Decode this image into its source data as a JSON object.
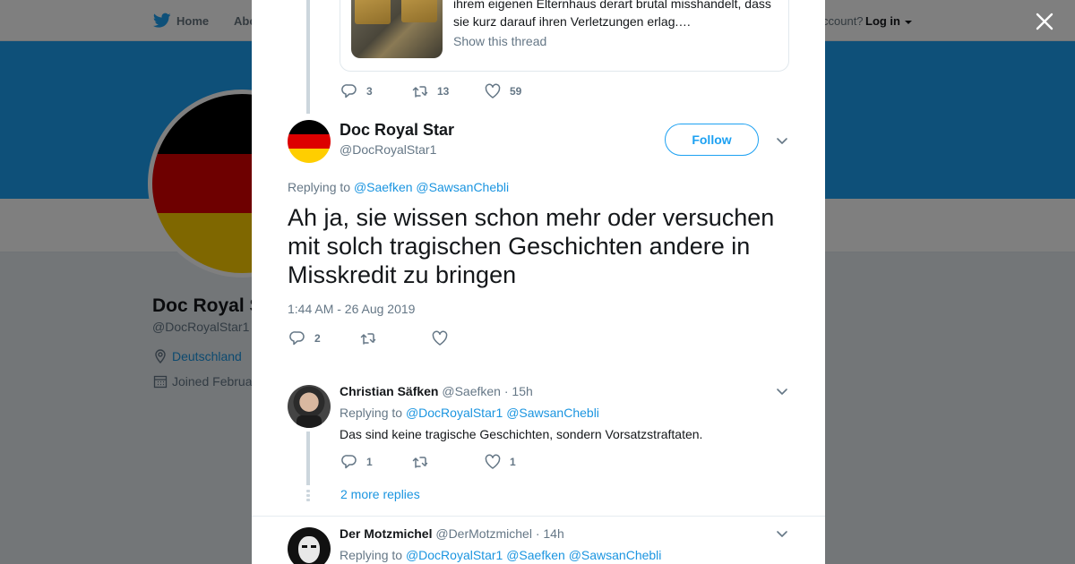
{
  "background": {
    "nav": {
      "home": "Home",
      "about": "Abo",
      "account_prompt": "ccount?",
      "login": "Log in"
    },
    "profile": {
      "name": "Doc Royal S",
      "handle": "@DocRoyalStar1",
      "location": "Deutschland",
      "joined": "Joined Februa"
    }
  },
  "quoted_tweet": {
    "text": "ihrem eigenen Elternhaus derart brutal misshandelt, dass sie kurz darauf ihren Verletzungen erlag.…",
    "show_thread": "Show this thread",
    "replies": "3",
    "retweets": "13",
    "likes": "59"
  },
  "main_tweet": {
    "name": "Doc Royal Star",
    "handle": "@DocRoyalStar1",
    "follow": "Follow",
    "replying_to_label": "Replying to",
    "replying_to": [
      "@Saefken",
      "@SawsanChebli"
    ],
    "text": "Ah ja, sie wissen schon mehr oder versuchen mit solch tragischen Geschichten andere in Misskredit zu bringen",
    "timestamp": "1:44 AM - 26 Aug 2019",
    "replies": "2"
  },
  "replies": [
    {
      "name": "Christian Säfken",
      "handle": "@Saefken",
      "time": "15h",
      "replying_to_label": "Replying to",
      "replying_to": [
        "@DocRoyalStar1",
        "@SawsanChebli"
      ],
      "text": "Das sind keine tragische Geschichten, sondern Vorsatzstraftaten.",
      "replies": "1",
      "likes": "1"
    },
    {
      "name": "Der Motzmichel",
      "handle": "@DerMotzmichel",
      "time": "14h",
      "replying_to_label": "Replying to",
      "replying_to": [
        "@DocRoyalStar1",
        "@Saefken",
        "@SawsanChebli"
      ]
    }
  ],
  "more_replies": "2 more replies",
  "separator": "·",
  "colors": {
    "accent": "#1da1f2",
    "link": "#1b95e0",
    "muted": "#657786",
    "overlay": "rgba(0,0,0,0.5)"
  },
  "icons": [
    "twitter-bird-icon",
    "reply-icon",
    "retweet-icon",
    "like-icon",
    "chevron-down-icon",
    "close-icon",
    "location-icon",
    "calendar-icon"
  ]
}
